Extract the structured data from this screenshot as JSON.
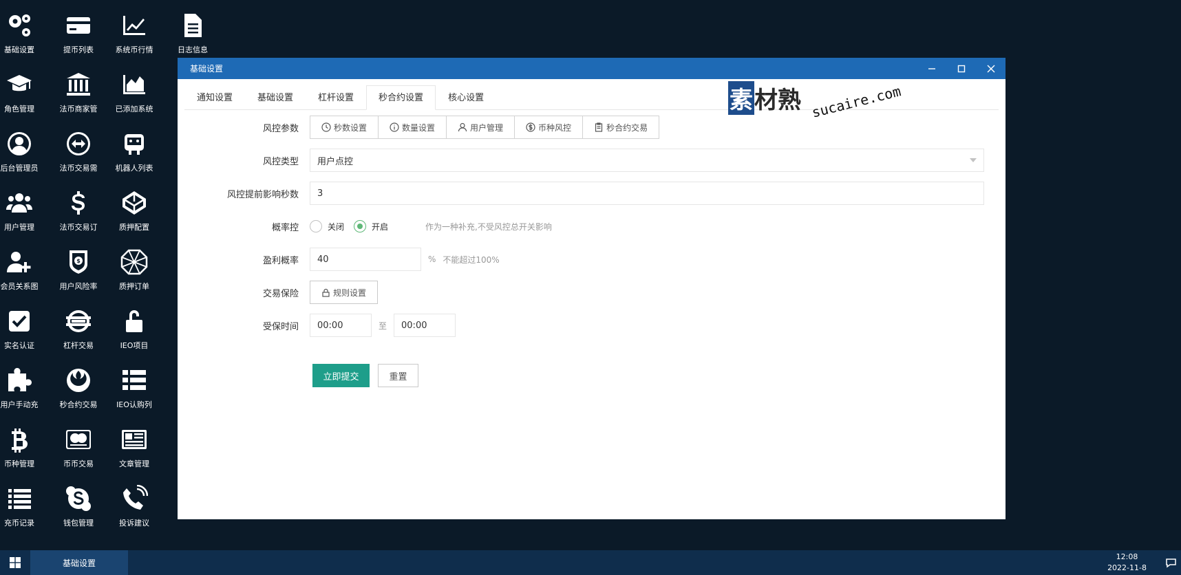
{
  "desktop": {
    "icons": [
      {
        "label": "基础设置",
        "icon": "gears-icon"
      },
      {
        "label": "提币列表",
        "icon": "credit-card-icon"
      },
      {
        "label": "系统币行情",
        "icon": "line-chart-icon"
      },
      {
        "label": "日志信息",
        "icon": "document-icon"
      },
      {
        "label": "角色管理",
        "icon": "graduation-cap-icon"
      },
      {
        "label": "法币商家管",
        "icon": "bank-icon"
      },
      {
        "label": "已添加系统",
        "icon": "area-chart-icon"
      },
      {
        "label": "后台管理员",
        "icon": "user-circle-icon"
      },
      {
        "label": "法币交易需",
        "icon": "exchange-icon"
      },
      {
        "label": "机器人列表",
        "icon": "robot-icon"
      },
      {
        "label": "用户管理",
        "icon": "users-icon"
      },
      {
        "label": "法币交易订",
        "icon": "dollar-icon"
      },
      {
        "label": "质押配置",
        "icon": "codepen-icon"
      },
      {
        "label": "会员关系图",
        "icon": "user-plus-icon"
      },
      {
        "label": "用户风险率",
        "icon": "shield-icon"
      },
      {
        "label": "质押订单",
        "icon": "polygon-icon"
      },
      {
        "label": "实名认证",
        "icon": "check-square-icon"
      },
      {
        "label": "杠杆交易",
        "icon": "lever-icon"
      },
      {
        "label": "IEO项目",
        "icon": "unlock-icon"
      },
      {
        "label": "用户手动充",
        "icon": "puzzle-icon"
      },
      {
        "label": "秒合约交易",
        "icon": "rebel-icon"
      },
      {
        "label": "IEO认购列",
        "icon": "list-icon"
      },
      {
        "label": "币种管理",
        "icon": "bitcoin-icon"
      },
      {
        "label": "币币交易",
        "icon": "mastercard-icon"
      },
      {
        "label": "文章管理",
        "icon": "newspaper-icon"
      },
      {
        "label": "充币记录",
        "icon": "list-lines-icon"
      },
      {
        "label": "钱包管理",
        "icon": "skype-icon"
      },
      {
        "label": "投诉建议",
        "icon": "phone-icon"
      }
    ]
  },
  "window": {
    "title": "基础设置",
    "tabs": [
      "通知设置",
      "基础设置",
      "杠杆设置",
      "秒合约设置",
      "核心设置"
    ],
    "active_tab": "秒合约设置",
    "watermark": {
      "main": "素材熟",
      "sub": "sucaire.com"
    }
  },
  "form": {
    "risk_params": {
      "label": "风控参数",
      "buttons": [
        {
          "label": "秒数设置",
          "icon": "clock-icon"
        },
        {
          "label": "数量设置",
          "icon": "info-icon"
        },
        {
          "label": "用户管理",
          "icon": "user-icon"
        },
        {
          "label": "币种风控",
          "icon": "coin-icon"
        },
        {
          "label": "秒合约交易",
          "icon": "clipboard-icon"
        }
      ]
    },
    "risk_type": {
      "label": "风控类型",
      "value": "用户点控"
    },
    "risk_seconds": {
      "label": "风控提前影响秒数",
      "value": "3"
    },
    "probability": {
      "label": "概率控",
      "options": [
        "关闭",
        "开启"
      ],
      "selected": "开启",
      "hint": "作为一种补充,不受风控总开关影响"
    },
    "profit_rate": {
      "label": "盈利概率",
      "value": "40",
      "unit": "%",
      "hint": "不能超过100%"
    },
    "insurance": {
      "label": "交易保险",
      "button": "规则设置"
    },
    "protected_time": {
      "label": "受保时间",
      "from": "00:00",
      "sep": "至",
      "to": "00:00"
    },
    "submit": "立即提交",
    "reset": "重置"
  },
  "taskbar": {
    "item": "基础设置",
    "time": "12:08",
    "date": "2022-11-8"
  },
  "colors": {
    "desktop_bg": "#0b1a28",
    "titlebar": "#1e6ab5",
    "primary_button": "#1e9e8a",
    "radio_on": "#5fb878",
    "taskbar": "#0f2d4c"
  }
}
